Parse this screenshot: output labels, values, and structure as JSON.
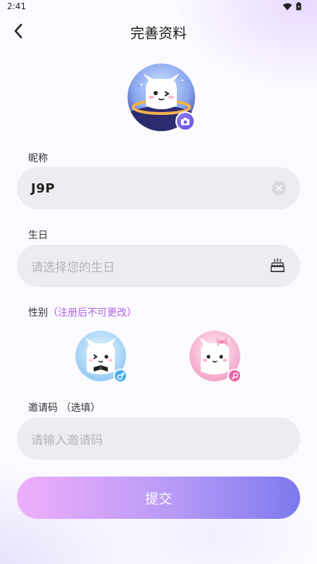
{
  "status_bar": {
    "time": "2:41"
  },
  "header": {
    "title": "完善资料"
  },
  "nickname": {
    "label": "昵称",
    "value": "J9P"
  },
  "birthday": {
    "label": "生日",
    "placeholder": "请选择您的生日"
  },
  "gender": {
    "label": "性别",
    "hint": "（注册后不可更改）"
  },
  "invite": {
    "label": "邀请码 （选填）",
    "placeholder": "请输入邀请码"
  },
  "submit": {
    "label": "提交"
  },
  "colors": {
    "accent": "#7d79ee",
    "hint": "#b060e6",
    "male": "#46a9f0",
    "female": "#ef5fa3"
  }
}
